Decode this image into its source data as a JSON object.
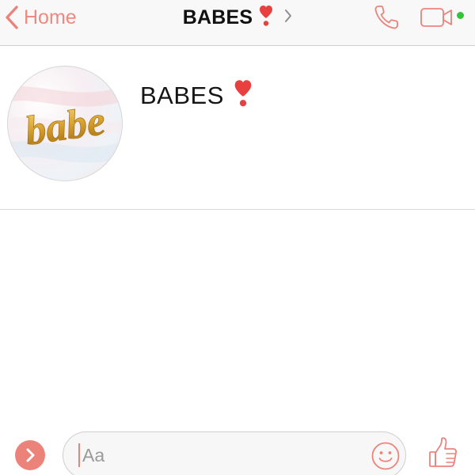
{
  "navbar": {
    "back_label": "Home",
    "title": "BABES",
    "title_emoji_icon": "heart-exclamation-icon",
    "chevron_icon": "chevron-right-icon",
    "call_icon": "phone-icon",
    "video_icon": "video-camera-icon",
    "online_status": "online"
  },
  "conversation": {
    "group_name": "BABES",
    "group_emoji_icon": "heart-exclamation-icon",
    "avatar_text": "babe"
  },
  "composer": {
    "placeholder": "Aa",
    "value": "",
    "expand_icon": "chevron-right-icon",
    "emoji_icon": "smiley-icon",
    "like_icon": "thumbs-up-icon"
  },
  "colors": {
    "accent": "#ec837a",
    "online": "#33c43a",
    "nav_background": "#f8f8f8",
    "title_text": "#111111",
    "heart_red": "#e8403e"
  }
}
